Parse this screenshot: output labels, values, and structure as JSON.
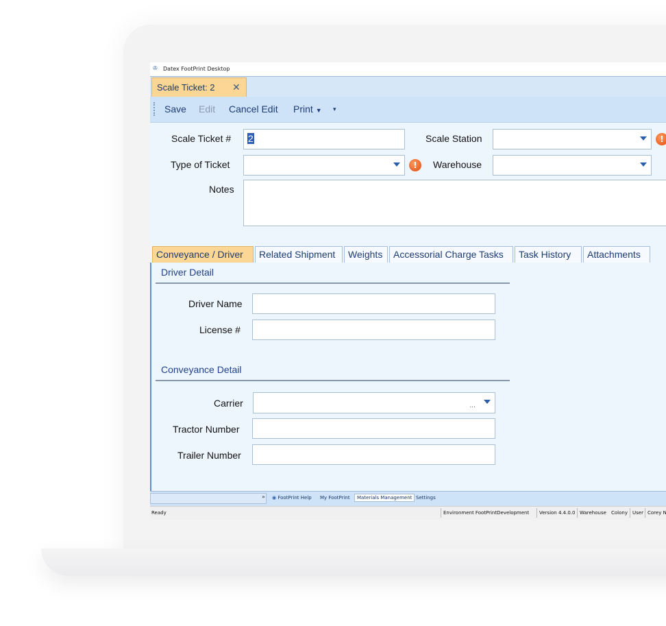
{
  "app": {
    "window_title": "Datex FootPrint Desktop"
  },
  "document_tab": {
    "label": "Scale Ticket: 2",
    "close_symbol": "✕"
  },
  "toolbar": {
    "save": "Save",
    "edit": "Edit",
    "cancel_edit": "Cancel Edit",
    "print": "Print",
    "dropdown_caret": "▼",
    "overflow_symbol": "▾"
  },
  "form": {
    "scale_ticket_label": "Scale Ticket #",
    "scale_ticket_value": "2",
    "scale_station_label": "Scale Station",
    "scale_station_value": "",
    "type_of_ticket_label": "Type of Ticket",
    "type_of_ticket_value": "",
    "warehouse_label": "Warehouse",
    "warehouse_value": "",
    "notes_label": "Notes",
    "notes_value": "",
    "error_symbol": "!"
  },
  "tabs": [
    {
      "label": "Conveyance / Driver",
      "active": true
    },
    {
      "label": "Related Shipment",
      "active": false
    },
    {
      "label": "Weights",
      "active": false
    },
    {
      "label": "Accessorial Charge Tasks",
      "active": false
    },
    {
      "label": "Task History",
      "active": false
    },
    {
      "label": "Attachments",
      "active": false
    }
  ],
  "driver_detail": {
    "title": "Driver Detail",
    "driver_name_label": "Driver Name",
    "driver_name_value": "",
    "license_label": "License #",
    "license_value": ""
  },
  "conveyance_detail": {
    "title": "Conveyance Detail",
    "carrier_label": "Carrier",
    "carrier_value": "",
    "carrier_ellipsis": "...",
    "tractor_label": "Tractor Number",
    "tractor_value": "",
    "trailer_label": "Trailer Number",
    "trailer_value": ""
  },
  "bottom_tabs": {
    "chevron": "»",
    "help": "FootPrint Help",
    "my_footprint": "My FootPrint",
    "materials": "Materials Management",
    "settings": "Settings"
  },
  "status_bar": {
    "ready": "Ready",
    "environment": "Environment FootPrintDevelopment",
    "version": "Version 4.4.0.0",
    "warehouse": "Warehouse",
    "warehouse_value": "Colony",
    "user": "User",
    "user_value": "Corey N"
  },
  "colors": {
    "accent": "#fbd695",
    "band": "#d6e7f8",
    "panel": "#eef6fd",
    "error": "#e04a10",
    "section_title": "#1f3f8a"
  }
}
